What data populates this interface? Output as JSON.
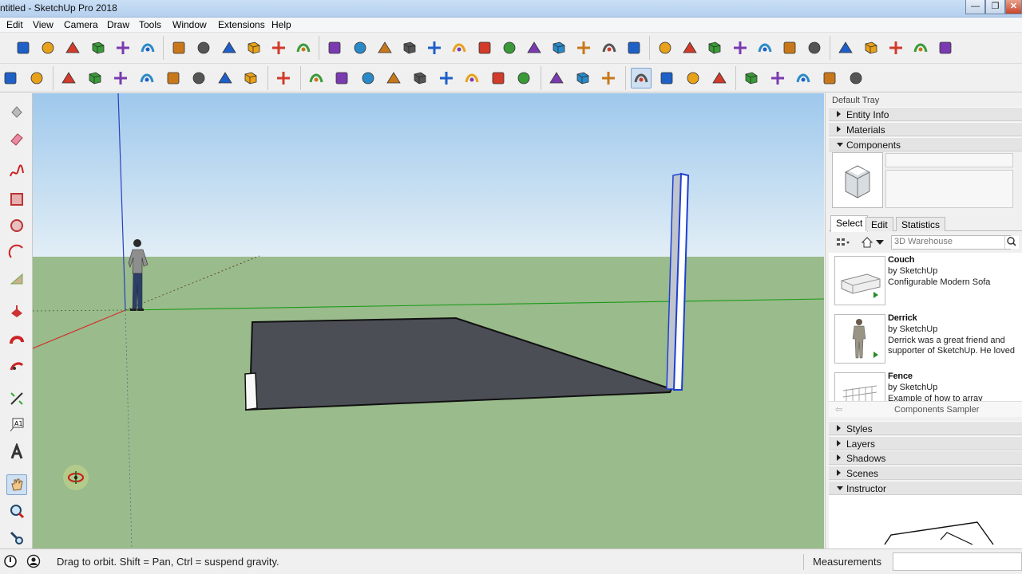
{
  "window": {
    "title": "ntitled - SketchUp Pro 2018",
    "minimize": "—",
    "maximize": "❐",
    "close": "✕"
  },
  "menu": [
    "Edit",
    "View",
    "Camera",
    "Draw",
    "Tools",
    "Window",
    "Extensions",
    "Help"
  ],
  "tray": {
    "title": "Default Tray",
    "panels_top": [
      {
        "label": "Entity Info",
        "expanded": false
      },
      {
        "label": "Materials",
        "expanded": false
      },
      {
        "label": "Components",
        "expanded": true
      }
    ],
    "tabs": [
      "Select",
      "Edit",
      "Statistics"
    ],
    "active_tab": "Select",
    "search_placeholder": "3D Warehouse",
    "components": [
      {
        "name": "Couch",
        "by": "by SketchUp",
        "desc": "Configurable Modern Sofa"
      },
      {
        "name": "Derrick",
        "by": "by SketchUp",
        "desc": "Derrick was a great friend and supporter of SketchUp. He loved ..."
      },
      {
        "name": "Fence",
        "by": "by SketchUp",
        "desc": "Example of how to array objects..."
      }
    ],
    "sampler": "Components Sampler",
    "panels_bottom": [
      {
        "label": "Styles",
        "expanded": false
      },
      {
        "label": "Layers",
        "expanded": false
      },
      {
        "label": "Shadows",
        "expanded": false
      },
      {
        "label": "Scenes",
        "expanded": false
      },
      {
        "label": "Instructor",
        "expanded": true
      }
    ]
  },
  "status": {
    "message": "Drag to orbit. Shift = Pan, Ctrl = suspend gravity.",
    "measurements_label": "Measurements",
    "measurements_value": ""
  },
  "colors": {
    "sky_top": "#9ec8ec",
    "sky_bottom": "#e2eef6",
    "ground": "#9abb8b",
    "slab": "#4b4e55",
    "accent_blue": "#2a5fd6"
  },
  "toolbar_icons_row1": [
    "warehouse-icon",
    "sun-icon",
    "shadow-icon",
    "moon-icon",
    "share-icon",
    "component-icon",
    "north-icon",
    "n-arrow-icon",
    "section-icon",
    "paper-icon",
    "box-icon",
    "select-box-icon",
    "globe-icon",
    "axes-icon",
    "protractor-icon",
    "utm-icon",
    "grid-icon",
    "arrow-icon",
    "sun2-icon",
    "snow-icon",
    "mountain-icon",
    "terrain-icon",
    "purple-shape-icon",
    "purple-shape2-icon",
    "plus-icon",
    "solar-icon",
    "database-icon",
    "arch-icon",
    "lines-icon",
    "help-icon",
    "gear-icon",
    "sketchup-logo-icon",
    "view-iso-icon",
    "view-top-icon",
    "view-front-icon",
    "view-right-icon",
    "view-back-icon"
  ],
  "toolbar_icons_row2": [
    "open-icon",
    "save-icon",
    "cut-icon",
    "copy-icon",
    "paste-icon",
    "erase-icon",
    "undo-icon",
    "redo-icon",
    "print-icon",
    "model-info-icon",
    "select-tool-icon",
    "eraser-tool-icon",
    "pencil-icon",
    "arc-icon",
    "shape-icon",
    "push-pull-icon",
    "follow-me-icon",
    "move-icon",
    "rotate-icon",
    "scale-icon",
    "tape-measure-icon",
    "text-icon",
    "paint-bucket-icon",
    "orbit-icon",
    "pan-icon",
    "zoom-icon",
    "zoom-extents-icon",
    "ruby-icon",
    "ruby2-icon",
    "export-icon",
    "ruby3-icon",
    "style-icon"
  ]
}
